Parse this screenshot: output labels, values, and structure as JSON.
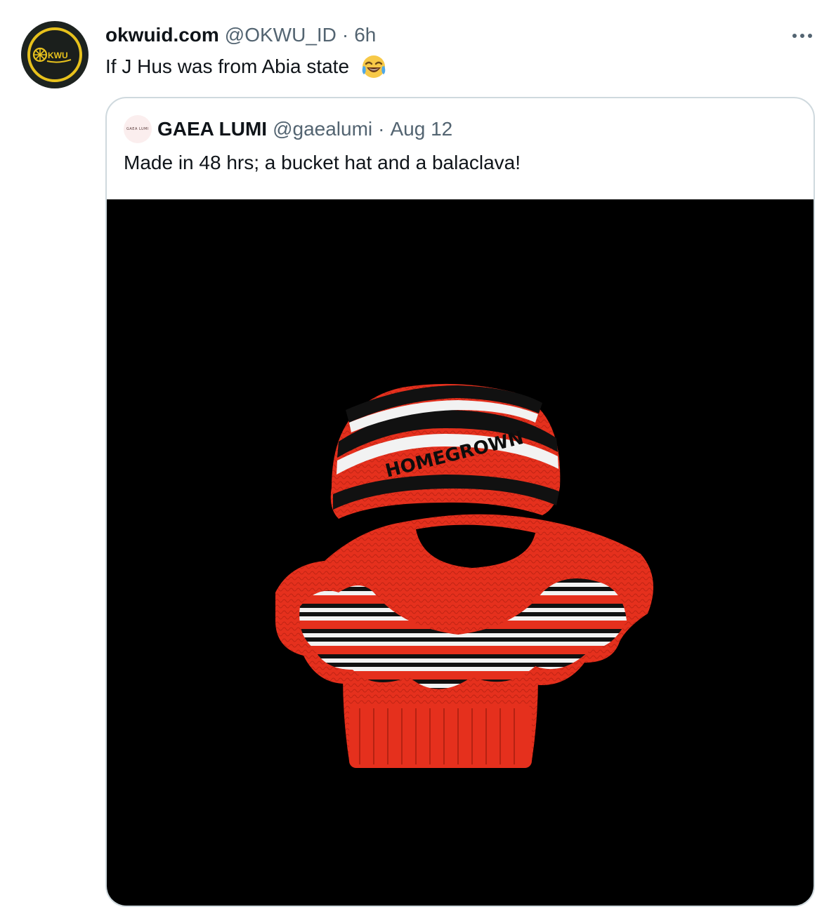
{
  "tweet": {
    "display_name": "okwuid.com",
    "handle": "@OKWU_ID",
    "separator": "·",
    "time": "6h",
    "text": "If J Hus was from Abia state",
    "emoji": "face-with-tears-of-joy-icon",
    "avatar_icon": "okwu-logo-avatar",
    "avatar_text": "KWU"
  },
  "quoted": {
    "display_name": "GAEA LUMI",
    "handle": "@gaealumi",
    "separator": "·",
    "date": "Aug 12",
    "text": "Made in 48 hrs; a bucket hat and a balaclava!",
    "avatar_text": "GAEA LUMI",
    "media_icon": "crochet-bucket-hat-balaclava-photo",
    "media_text": "HOMEGROWN"
  },
  "colors": {
    "text_primary": "#0f1419",
    "text_secondary": "#536471",
    "border": "#cfd9de",
    "avatar_ring": "#e8c21c",
    "hat_red": "#e5301d",
    "media_background": "#000000"
  }
}
